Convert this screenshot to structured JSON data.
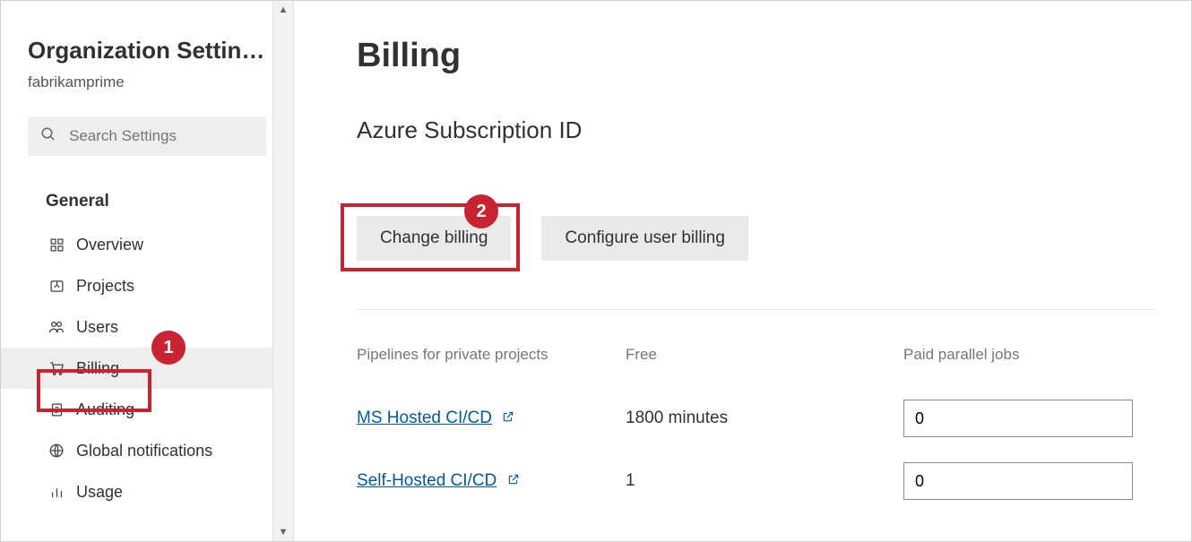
{
  "sidebar": {
    "title": "Organization Settin…",
    "subtitle": "fabrikamprime",
    "searchPlaceholder": "Search Settings",
    "sectionLabel": "General",
    "items": [
      {
        "label": "Overview",
        "icon": "overview-icon",
        "active": false
      },
      {
        "label": "Projects",
        "icon": "projects-icon",
        "active": false
      },
      {
        "label": "Users",
        "icon": "users-icon",
        "active": false
      },
      {
        "label": "Billing",
        "icon": "cart-icon",
        "active": true
      },
      {
        "label": "Auditing",
        "icon": "auditing-icon",
        "active": false
      },
      {
        "label": "Global notifications",
        "icon": "notifications-icon",
        "active": false
      },
      {
        "label": "Usage",
        "icon": "usage-icon",
        "active": false
      }
    ]
  },
  "callouts": {
    "one": "1",
    "two": "2"
  },
  "main": {
    "title": "Billing",
    "subTitle": "Azure Subscription ID",
    "buttons": {
      "changeBilling": "Change billing",
      "configureUserBilling": "Configure user billing"
    },
    "table": {
      "headers": {
        "pipelines": "Pipelines for private projects",
        "free": "Free",
        "paid": "Paid parallel jobs"
      },
      "rows": [
        {
          "label": "MS Hosted CI/CD",
          "free": "1800 minutes",
          "paid": "0"
        },
        {
          "label": "Self-Hosted CI/CD",
          "free": "1",
          "paid": "0"
        }
      ]
    }
  }
}
